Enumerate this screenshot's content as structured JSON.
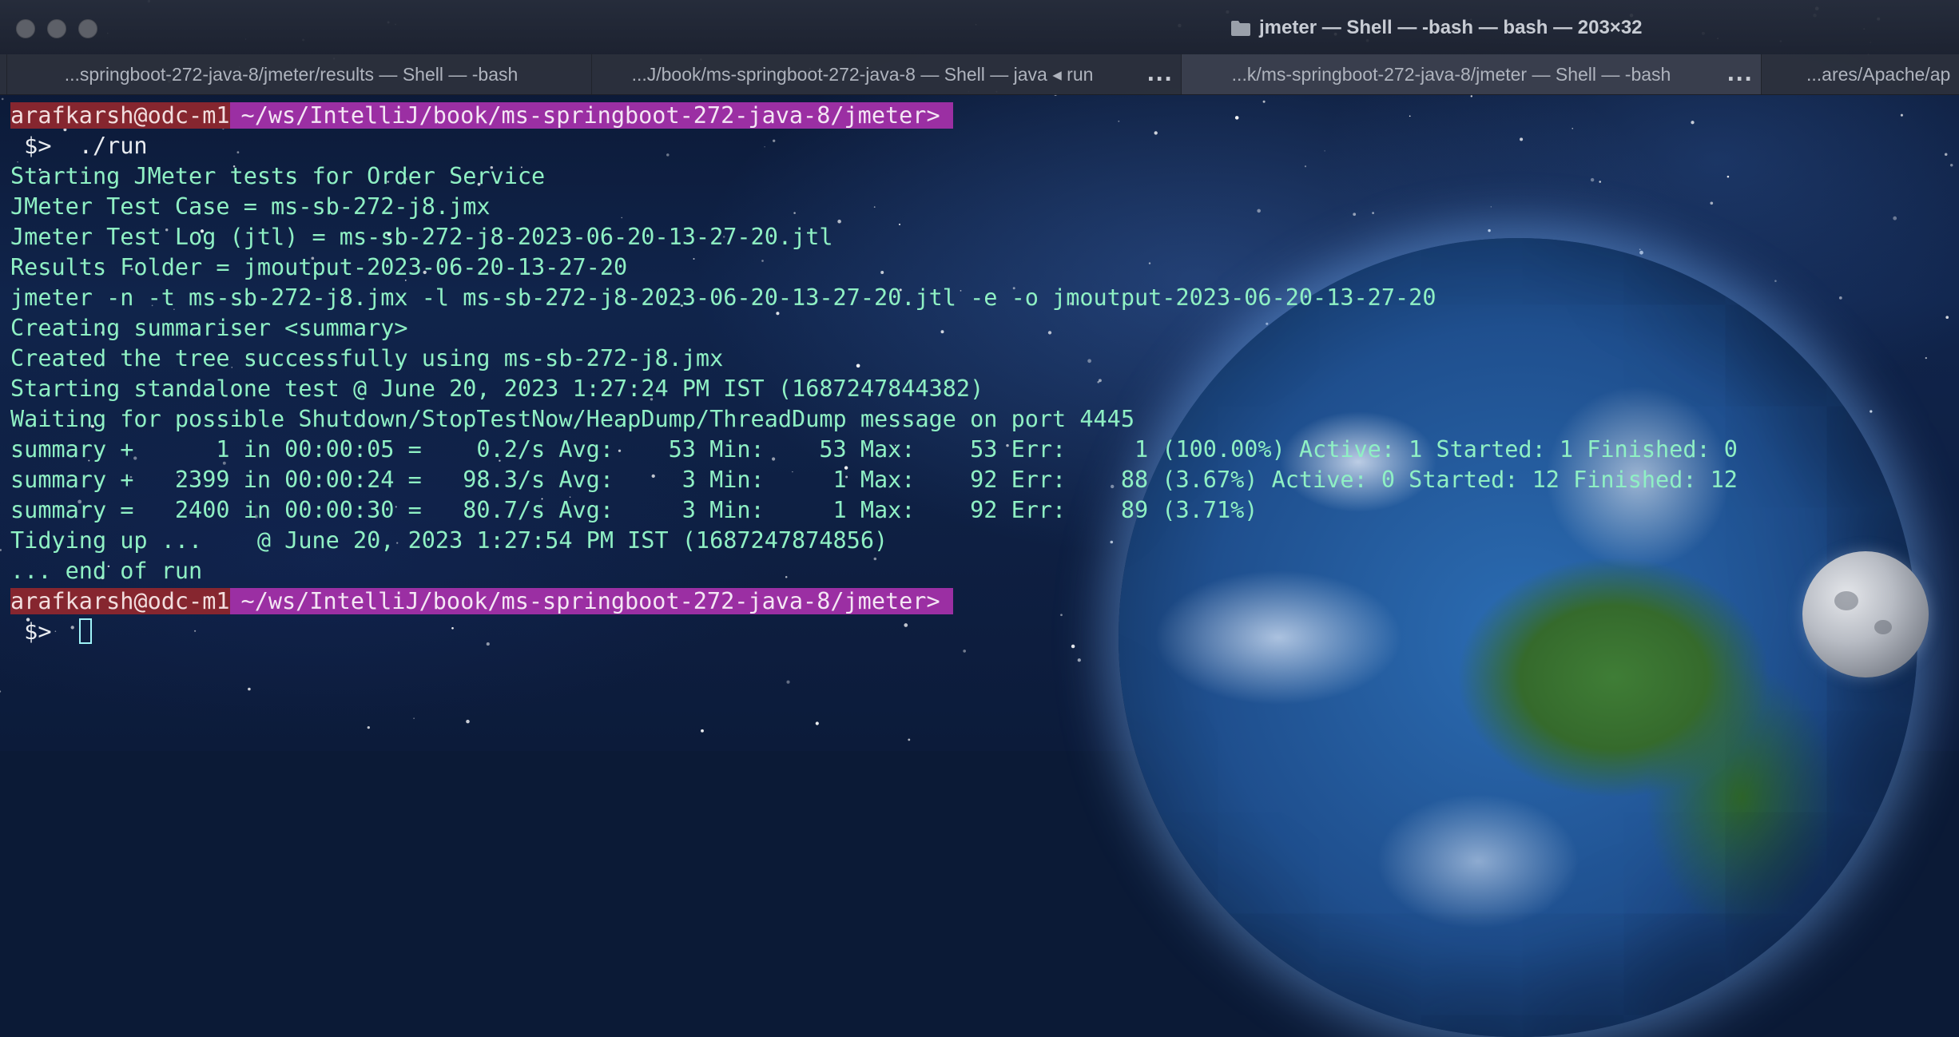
{
  "window": {
    "title": "jmeter — Shell — -bash — bash — 203×32"
  },
  "tabs": [
    {
      "label": "...springboot-272-java-8/jmeter/results — Shell — -bash",
      "more": ""
    },
    {
      "label": "...J/book/ms-springboot-272-java-8 — Shell — java ◂ run",
      "more": "..."
    },
    {
      "label": "...k/ms-springboot-272-java-8/jmeter — Shell — -bash",
      "more": "..."
    },
    {
      "label": "...ares/Apache/ap",
      "more": ""
    }
  ],
  "terminal": {
    "prompt1": {
      "user": "arafkarsh@odc-m1",
      "path": "~/ws/IntelliJ/book/ms-springboot-272-java-8/jmeter>"
    },
    "cmd1": {
      "ps1": " $> ",
      "command": " ./run"
    },
    "output": [
      "Starting JMeter tests for Order Service",
      "JMeter Test Case = ms-sb-272-j8.jmx",
      "Jmeter Test Log (jtl) = ms-sb-272-j8-2023-06-20-13-27-20.jtl",
      "Results Folder = jmoutput-2023-06-20-13-27-20",
      "jmeter -n -t ms-sb-272-j8.jmx -l ms-sb-272-j8-2023-06-20-13-27-20.jtl -e -o jmoutput-2023-06-20-13-27-20",
      "Creating summariser <summary>",
      "Created the tree successfully using ms-sb-272-j8.jmx",
      "Starting standalone test @ June 20, 2023 1:27:24 PM IST (1687247844382)",
      "Waiting for possible Shutdown/StopTestNow/HeapDump/ThreadDump message on port 4445",
      "summary +      1 in 00:00:05 =    0.2/s Avg:    53 Min:    53 Max:    53 Err:     1 (100.00%) Active: 1 Started: 1 Finished: 0",
      "summary +   2399 in 00:00:24 =   98.3/s Avg:     3 Min:     1 Max:    92 Err:    88 (3.67%) Active: 0 Started: 12 Finished: 12",
      "summary =   2400 in 00:00:30 =   80.7/s Avg:     3 Min:     1 Max:    92 Err:    89 (3.71%)",
      "Tidying up ...    @ June 20, 2023 1:27:54 PM IST (1687247874856)",
      "... end of run"
    ],
    "prompt2": {
      "user": "arafkarsh@odc-m1",
      "path": "~/ws/IntelliJ/book/ms-springboot-272-java-8/jmeter>"
    },
    "cmd2": {
      "ps1": " $>  "
    }
  },
  "colors": {
    "output_text": "#8ff0c4",
    "prompt_user_bg": "#86262f",
    "prompt_path_bg": "#9b2fa3"
  },
  "icons": {
    "title": "folder-icon",
    "window_controls": [
      "close-button",
      "minimize-button",
      "zoom-button"
    ]
  }
}
